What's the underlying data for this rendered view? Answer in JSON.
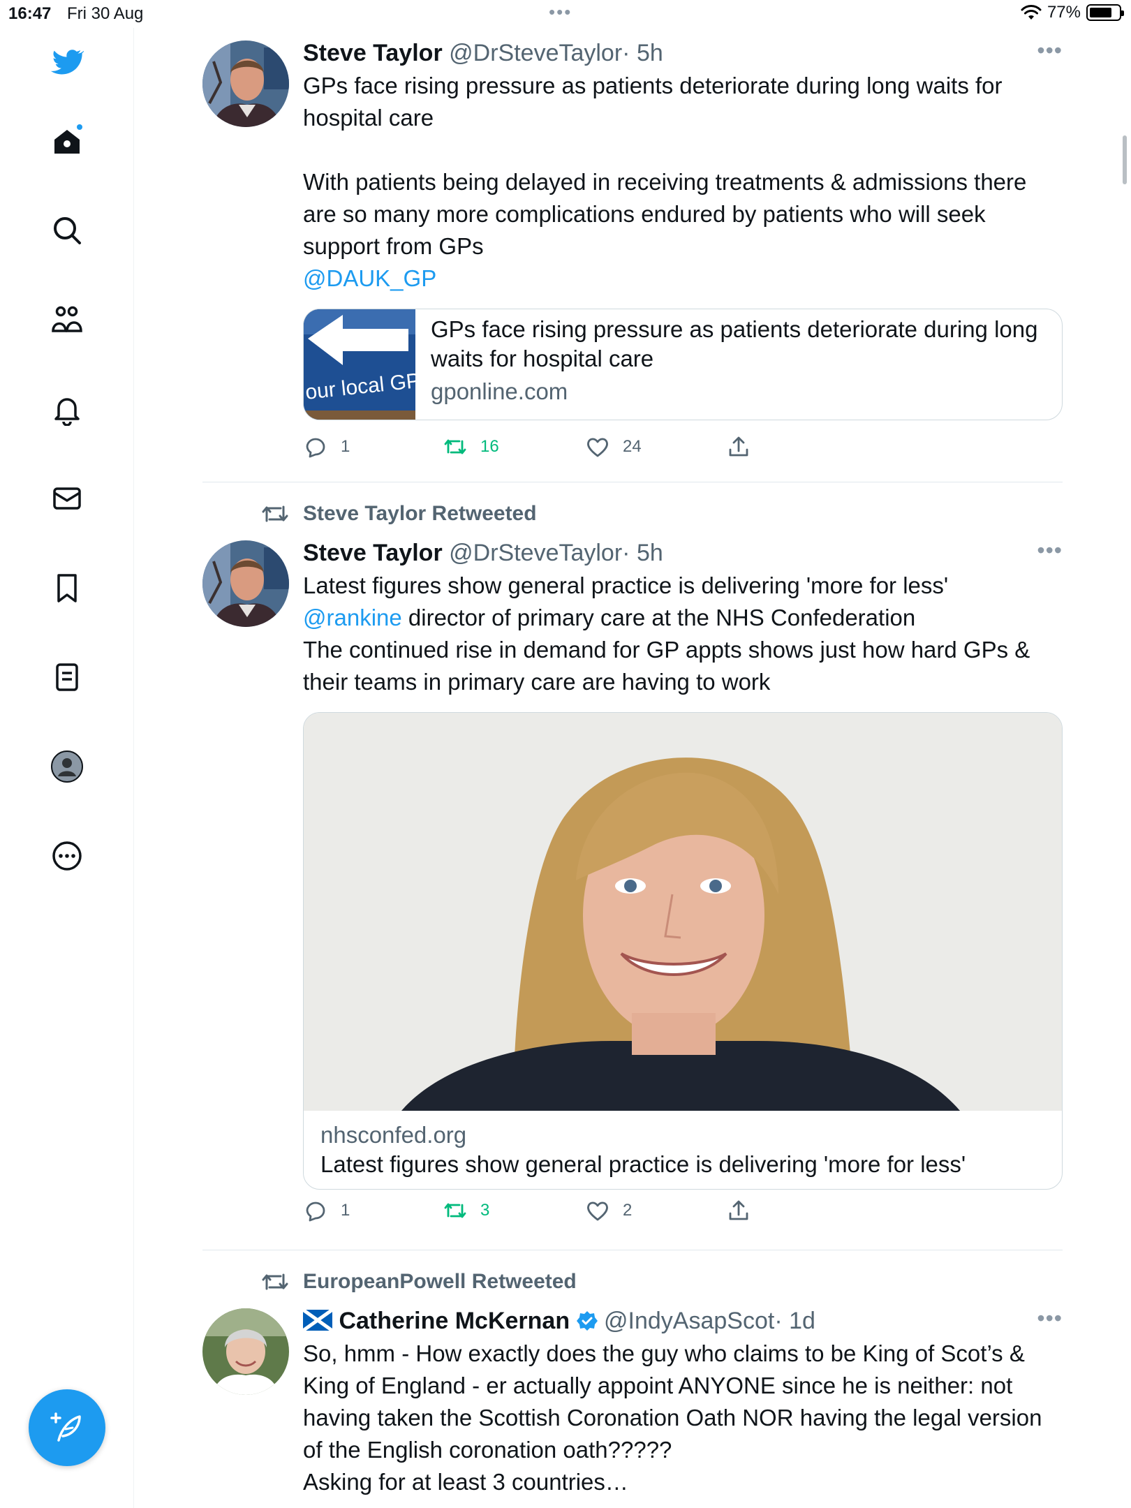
{
  "status_bar": {
    "time": "16:47",
    "date": "Fri 30 Aug",
    "battery": "77%",
    "battery_level": 0.77
  },
  "sidebar": {
    "items": [
      "twitter-logo",
      "home",
      "explore",
      "communities",
      "notifications",
      "messages",
      "bookmarks",
      "lists",
      "profile",
      "more"
    ]
  },
  "tweets": [
    {
      "name": "Steve Taylor",
      "handle": "@DrSteveTaylor",
      "time": "· 5h",
      "text_line1": "GPs face rising pressure as patients deteriorate during long waits for hospital care",
      "text_line2": "With patients being delayed in receiving treatments & admissions there are so many more complications endured by patients who will seek support from GPs",
      "mention": "@DAUK_GP",
      "card": {
        "title": "GPs face rising pressure as patients deteriorate during long waits for hospital care",
        "domain": "gponline.com",
        "thumb_text": "our local GP Su"
      },
      "replies": "1",
      "retweets": "16",
      "likes": "24"
    },
    {
      "retweeted_by": "Steve Taylor Retweeted",
      "name": "Steve Taylor",
      "handle": "@DrSteveTaylor",
      "time": "· 5h",
      "text_line1": "Latest figures show general practice is delivering 'more for less'",
      "mention": "@rankine",
      "text_line2": " director of primary care at the NHS Confederation",
      "text_line3": "The continued rise in demand for GP appts shows just how hard GPs & their teams in primary care are having to work",
      "card": {
        "domain": "nhsconfed.org",
        "title": "Latest figures show general practice is delivering 'more for less'"
      },
      "replies": "1",
      "retweets": "3",
      "likes": "2"
    },
    {
      "retweeted_by": "EuropeanPowell Retweeted",
      "name": "Catherine McKernan",
      "handle": "@IndyAsapScot",
      "time": "· 1d",
      "text": "So, hmm - How exactly does the guy who claims to be King of Scot’s & King of England - er actually appoint ANYONE since he is neither: not having taken the Scottish Coronation Oath NOR having the legal version of the English coronation oath?????",
      "text_line2": "Asking for at least 3 countries…"
    }
  ],
  "colors": {
    "accent": "#1d9bf0",
    "retweet_green": "#00ba7c",
    "secondary_text": "#536471"
  }
}
